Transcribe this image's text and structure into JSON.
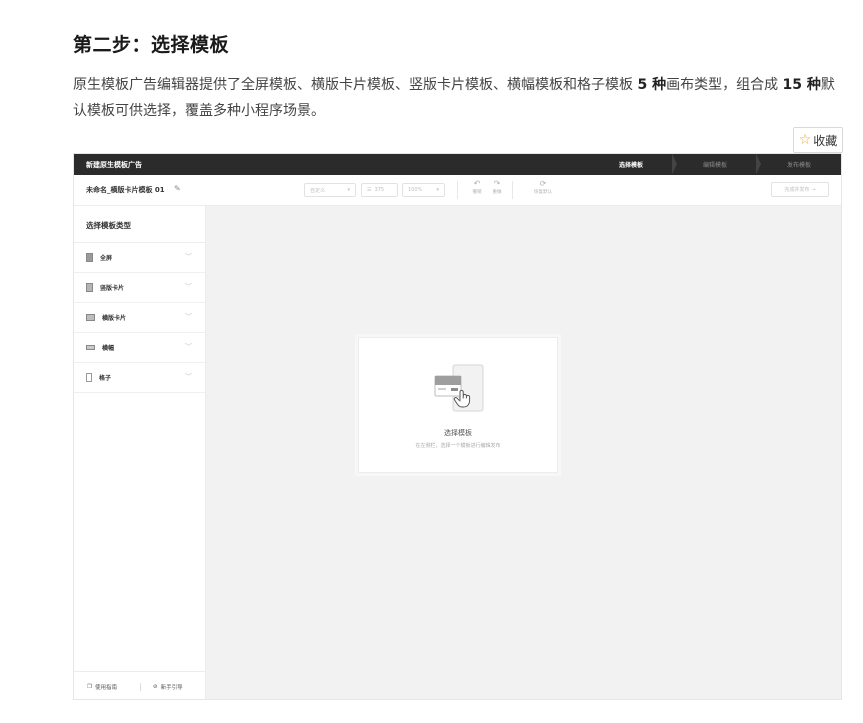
{
  "doc": {
    "title": "第二步：选择模板",
    "para_part1": "原生模板广告编辑器提供了全屏模板、横版卡片模板、竖版卡片模板、横幅模板和格子模板 ",
    "para_bold1": "5 种",
    "para_part2": "画布类型，组合成 ",
    "para_bold2": "15 种",
    "para_part3": "默认模板可供选择，覆盖多种小程序场景。",
    "favorite_label": "收藏",
    "favorite_icon": "star-icon"
  },
  "editor": {
    "app_title": "新建原生模板广告",
    "steps": [
      {
        "label": "选择模板",
        "active": true
      },
      {
        "label": "编辑模板",
        "active": false
      },
      {
        "label": "发布模板",
        "active": false
      }
    ],
    "doc_name": "未命名_横版卡片模板 01",
    "toolbar": {
      "size_select": "自定义",
      "width_value": "375",
      "zoom_value": "100%",
      "undo_label": "撤销",
      "redo_label": "重做",
      "reset_label": "恢复默认",
      "publish_label": "完成并发布"
    },
    "sidebar": {
      "heading": "选择模板类型",
      "items": [
        {
          "label": "全屏",
          "icon": "fullscreen-icon"
        },
        {
          "label": "竖版卡片",
          "icon": "vertical-card-icon"
        },
        {
          "label": "横版卡片",
          "icon": "horizontal-card-icon"
        },
        {
          "label": "横幅",
          "icon": "banner-icon"
        },
        {
          "label": "格子",
          "icon": "grid-icon"
        }
      ],
      "footer_left": "使用指南",
      "footer_right": "新手引导"
    },
    "canvas": {
      "empty_title": "选择模板",
      "empty_subtitle": "在左侧栏，选择一个模板进行编辑发布"
    }
  }
}
